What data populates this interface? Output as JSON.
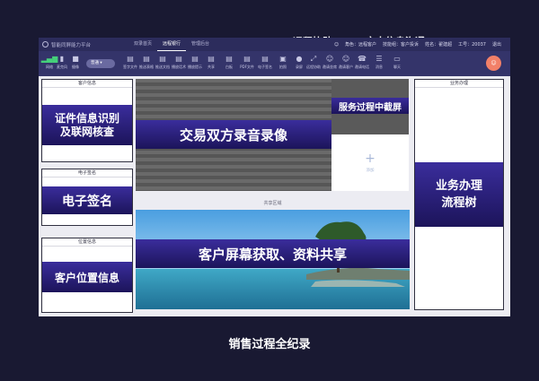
{
  "callouts": {
    "remote_assist": "远程协助",
    "text_chat": "文本信息沟通"
  },
  "topbar": {
    "app_name": "智能同屏能力平台",
    "tabs": [
      {
        "label": "双录首页",
        "active": false
      },
      {
        "label": "远程银行",
        "active": true
      },
      {
        "label": "管理后台",
        "active": false
      }
    ],
    "user": {
      "role": "角色：远程客户",
      "service": "技能组：客户投诉",
      "name": "姓名：翟建超",
      "work_id": "工号：20037",
      "logout": "退出"
    }
  },
  "toolbar": {
    "items": [
      {
        "icon": "signal-icon",
        "glyph": "▂▄▆",
        "label": "网络"
      },
      {
        "icon": "microphone-icon",
        "glyph": "🎤",
        "label": "麦克风"
      },
      {
        "icon": "camera-icon",
        "glyph": "■",
        "label": "摄像"
      },
      {
        "icon": "document-icon",
        "glyph": "▤",
        "label": "签字文件"
      },
      {
        "icon": "document-icon",
        "glyph": "▤",
        "label": "推送表格"
      },
      {
        "icon": "document-icon",
        "glyph": "▤",
        "label": "推送文档"
      },
      {
        "icon": "document-icon",
        "glyph": "▤",
        "label": "播放话术"
      },
      {
        "icon": "document-icon",
        "glyph": "▤",
        "label": "播放提示"
      },
      {
        "icon": "document-icon",
        "glyph": "▤",
        "label": "共享"
      },
      {
        "icon": "document-icon",
        "glyph": "▤",
        "label": "白板"
      },
      {
        "icon": "document-icon",
        "glyph": "▤",
        "label": "PDF文件"
      },
      {
        "icon": "document-icon",
        "glyph": "▤",
        "label": "电子签名"
      },
      {
        "icon": "photo-icon",
        "glyph": "▣",
        "label": "拍照"
      },
      {
        "icon": "record-icon",
        "glyph": "●",
        "label": "录屏"
      },
      {
        "icon": "remote-assist-icon",
        "glyph": "⤢",
        "label": "远程协助"
      },
      {
        "icon": "person-icon",
        "glyph": "☺",
        "label": "邀请坐席"
      },
      {
        "icon": "person-icon",
        "glyph": "☺",
        "label": "邀请客户"
      },
      {
        "icon": "phone-icon",
        "glyph": "☎",
        "label": "邀请电话"
      },
      {
        "icon": "chat-icon",
        "glyph": "☰",
        "label": "消息"
      },
      {
        "icon": "message-icon",
        "glyph": "▭",
        "label": "聊天"
      }
    ],
    "mode_toggle": "普通"
  },
  "panels": {
    "customer_info": {
      "title": "客户信息",
      "banner": "证件信息识别\n及联网核查"
    },
    "e_signature": {
      "title": "电子签名",
      "banner": "电子签名"
    },
    "location": {
      "title": "位置信息",
      "banner": "客户位置信息"
    },
    "business": {
      "title": "业务办理",
      "banner": "业务办理\n流程树"
    },
    "video_banner": "交易双方录音录像",
    "screenshot_banner": "服务过程中截屏",
    "add_label": "添加",
    "share_title": "共享区域",
    "share_banner": "客户屏幕获取、资料共享"
  },
  "caption": "销售过程全纪录",
  "colors": {
    "background": "#191932",
    "topbar": "#2c2c5c",
    "toolbar": "#34346a",
    "banner_top": "#3a2d9c",
    "banner_bottom": "#1c145a",
    "avatar": "#f28068"
  }
}
